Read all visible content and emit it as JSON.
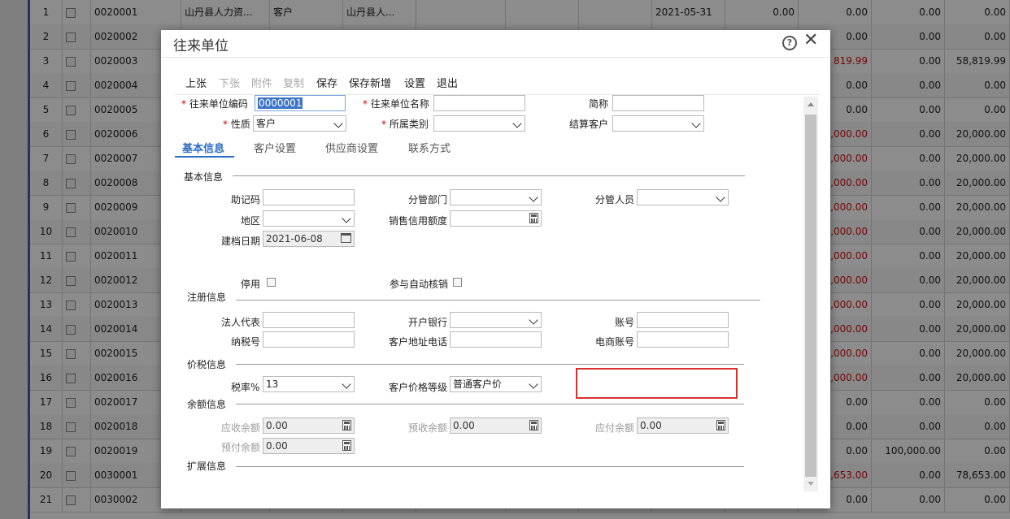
{
  "background_rows": [
    {
      "idx": "1",
      "code": "0020001",
      "name": "山丹县人力资...",
      "type": "客户",
      "region": "山丹县人...",
      "date": "2021-05-31",
      "v1": "0.00",
      "v2": "0.00",
      "v3": "0.00",
      "v4": "0.00",
      "red": false
    },
    {
      "idx": "2",
      "code": "0020002",
      "v2": "0.00",
      "v3": "0.00",
      "v4": "0.00",
      "red": false
    },
    {
      "idx": "3",
      "code": "0020003",
      "v2": "819.99",
      "v3": "0.00",
      "v4": "58,819.99",
      "red": true
    },
    {
      "idx": "4",
      "code": "0020004",
      "v2": "0.00",
      "v3": "0.00",
      "v4": "0.00",
      "red": false
    },
    {
      "idx": "5",
      "code": "0020005",
      "v2": "0.00",
      "v3": "0.00",
      "v4": "0.00",
      "red": false
    },
    {
      "idx": "6",
      "code": "0020006",
      "v2": ",000.00",
      "v3": "0.00",
      "v4": "20,000.00",
      "red": true
    },
    {
      "idx": "7",
      "code": "0020007",
      "v2": ",000.00",
      "v3": "0.00",
      "v4": "20,000.00",
      "red": true
    },
    {
      "idx": "8",
      "code": "0020008",
      "v2": ",000.00",
      "v3": "0.00",
      "v4": "20,000.00",
      "red": true
    },
    {
      "idx": "9",
      "code": "0020009",
      "v2": ",000.00",
      "v3": "0.00",
      "v4": "20,000.00",
      "red": true
    },
    {
      "idx": "10",
      "code": "0020010",
      "v2": ",000.00",
      "v3": "0.00",
      "v4": "20,000.00",
      "red": true
    },
    {
      "idx": "11",
      "code": "0020011",
      "v2": ",000.00",
      "v3": "0.00",
      "v4": "20,000.00",
      "red": true
    },
    {
      "idx": "12",
      "code": "0020012",
      "v2": ",000.00",
      "v3": "0.00",
      "v4": "20,000.00",
      "red": true
    },
    {
      "idx": "13",
      "code": "0020013",
      "v2": ",000.00",
      "v3": "0.00",
      "v4": "20,000.00",
      "red": true
    },
    {
      "idx": "14",
      "code": "0020014",
      "v2": ",000.00",
      "v3": "0.00",
      "v4": "20,000.00",
      "red": true
    },
    {
      "idx": "15",
      "code": "0020015",
      "v2": ",000.00",
      "v3": "0.00",
      "v4": "20,000.00",
      "red": true
    },
    {
      "idx": "16",
      "code": "0020016",
      "v2": ",000.00",
      "v3": "0.00",
      "v4": "20,000.00",
      "red": true
    },
    {
      "idx": "17",
      "code": "0020017",
      "v2": "0.00",
      "v3": "0.00",
      "v4": "0.00",
      "red": false
    },
    {
      "idx": "18",
      "code": "0020018",
      "v2": "0.00",
      "v3": "0.00",
      "v4": "0.00",
      "red": false
    },
    {
      "idx": "19",
      "code": "0020019",
      "v2": "0.00",
      "v3": "100,000.00",
      "v4": "0.00",
      "red": false
    },
    {
      "idx": "20",
      "code": "0030001",
      "v2": ",653.00",
      "v3": "0.00",
      "v4": "78,653.00",
      "red": true
    },
    {
      "idx": "21",
      "code": "0030002",
      "v2": "0.00",
      "v3": "0.00",
      "v4": "0.00",
      "red": false
    }
  ],
  "dialog": {
    "title": "往来单位",
    "help_icon": "?",
    "close_icon": "✕",
    "toolbar": {
      "prev": "上张",
      "next": "下张",
      "attach": "附件",
      "copy": "复制",
      "save": "保存",
      "save_new": "保存新增",
      "settings": "设置",
      "exit": "退出"
    },
    "header": {
      "req": "*",
      "code_label": "往来单位编码",
      "code_value": "0000001",
      "name_label": "往来单位名称",
      "name_value": "",
      "short_label": "简称",
      "short_value": "",
      "nature_label": "性质",
      "nature_value": "客户",
      "category_label": "所属类别",
      "category_value": "",
      "settle_label": "结算客户",
      "settle_value": ""
    },
    "tabs": [
      "基本信息",
      "客户设置",
      "供应商设置",
      "联系方式"
    ],
    "basic": {
      "section": "基本信息",
      "mnemonic_label": "助记码",
      "mnemonic_value": "",
      "dept_label": "分管部门",
      "dept_value": "",
      "staff_label": "分管人员",
      "staff_value": "",
      "region_label": "地区",
      "region_value": "",
      "credit_label": "销售信用额度",
      "credit_value": "",
      "date_label": "建档日期",
      "date_value": "2021-06-08",
      "disable_label": "停用",
      "autoverify_label": "参与自动核销"
    },
    "registration": {
      "section": "注册信息",
      "legal_label": "法人代表",
      "legal_value": "",
      "bank_label": "开户银行",
      "bank_value": "",
      "account_label": "账号",
      "account_value": "",
      "taxno_label": "纳税号",
      "taxno_value": "",
      "addr_label": "客户地址电话",
      "addr_value": "",
      "ecom_label": "电商账号",
      "ecom_value": ""
    },
    "price_tax": {
      "section": "价税信息",
      "tax_label": "税率%",
      "tax_value": "13",
      "price_level_label": "客户价格等级",
      "price_level_value": "普通客户价"
    },
    "balance": {
      "section": "余额信息",
      "receivable_label": "应收余额",
      "receivable_value": "0.00",
      "prereceive_label": "预收余额",
      "prereceive_value": "0.00",
      "payable_label": "应付余额",
      "payable_value": "0.00",
      "prepay_label": "预付余额",
      "prepay_value": "0.00"
    },
    "extended": {
      "section": "扩展信息"
    }
  },
  "colors": {
    "accent": "#2c6fc4",
    "required": "#d20000",
    "highlight_box": "#d83030"
  }
}
